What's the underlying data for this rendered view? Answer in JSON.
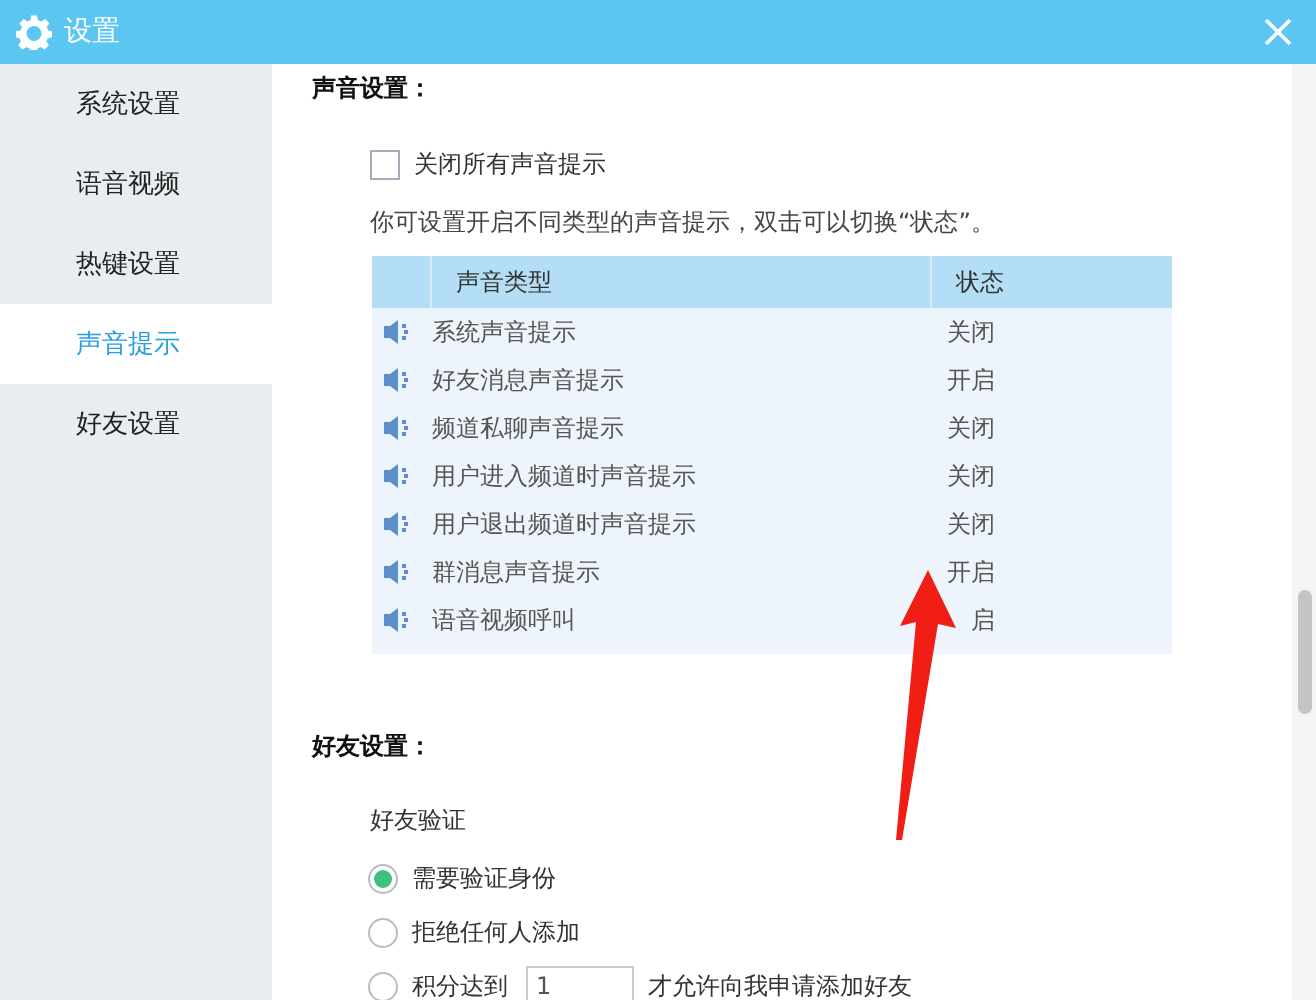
{
  "window": {
    "title": "设置"
  },
  "sidebar": {
    "items": [
      {
        "label": "系统设置",
        "selected": false
      },
      {
        "label": "语音视频",
        "selected": false
      },
      {
        "label": "热键设置",
        "selected": false
      },
      {
        "label": "声音提示",
        "selected": true
      },
      {
        "label": "好友设置",
        "selected": false
      }
    ]
  },
  "sound_settings": {
    "heading": "声音设置：",
    "mute_all": {
      "label": "关闭所有声音提示",
      "checked": false
    },
    "description": "你可设置开启不同类型的声音提示，双击可以切换“状态”。",
    "table": {
      "columns": [
        "声音类型",
        "状态"
      ],
      "rows": [
        {
          "type": "系统声音提示",
          "status": "关闭"
        },
        {
          "type": "好友消息声音提示",
          "status": "开启"
        },
        {
          "type": "频道私聊声音提示",
          "status": "关闭"
        },
        {
          "type": "用户进入频道时声音提示",
          "status": "关闭"
        },
        {
          "type": "用户退出频道时声音提示",
          "status": "关闭"
        },
        {
          "type": "群消息声音提示",
          "status": "开启"
        },
        {
          "type": "语音视频呼叫",
          "status": "启"
        }
      ]
    }
  },
  "friend_settings": {
    "heading": "好友设置：",
    "verification": {
      "label": "好友验证",
      "options": [
        {
          "kind": "plain",
          "label": "需要验证身份",
          "selected": true
        },
        {
          "kind": "plain",
          "label": "拒绝任何人添加",
          "selected": false
        },
        {
          "kind": "points",
          "label": "积分达到",
          "value": "1",
          "suffix": "才允许向我申请添加好友",
          "selected": false
        }
      ]
    }
  }
}
